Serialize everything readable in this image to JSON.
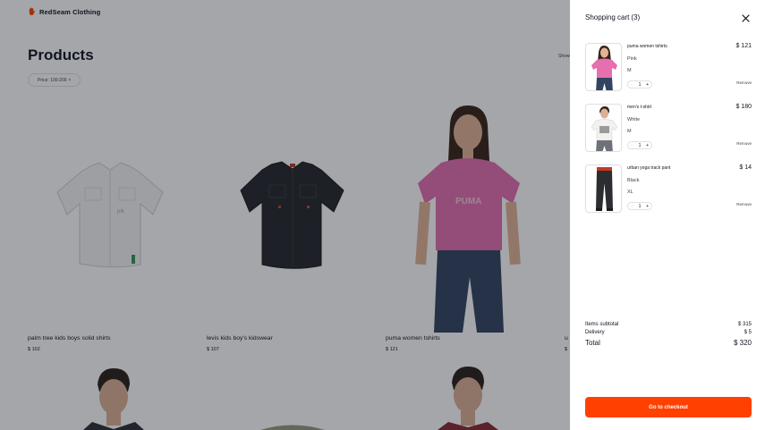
{
  "header": {
    "brand": "RedSeam Clothing",
    "logo_icon": "hand-logo-icon",
    "brand_color": "#ff4000"
  },
  "products_page": {
    "title": "Products",
    "showing_text": "Showi",
    "filter_chip": {
      "label": "Price: 100-200",
      "remove_symbol": "×"
    },
    "products": [
      {
        "name": "palm tree kids boys solid shirts",
        "price": "$ 102"
      },
      {
        "name": "levis kids boy's kidswear",
        "price": "$ 107"
      },
      {
        "name": "puma women tshirts",
        "price": "$ 121"
      },
      {
        "name": "u",
        "price": "$"
      }
    ]
  },
  "cart": {
    "title": "Shopping cart",
    "count": "(3)",
    "close_icon": "close-icon",
    "items": [
      {
        "name": "puma women tshirts",
        "color": "Pink",
        "size": "M",
        "quantity": "1",
        "price": "$ 121",
        "remove_label": "Remove",
        "minus": "−",
        "plus": "+"
      },
      {
        "name": "men's t-shirt",
        "color": "White",
        "size": "M",
        "quantity": "1",
        "price": "$ 180",
        "remove_label": "Remove",
        "minus": "−",
        "plus": "+"
      },
      {
        "name": "urban yoga track pant",
        "color": "Black",
        "size": "XL",
        "quantity": "1",
        "price": "$ 14",
        "remove_label": "Remove",
        "minus": "−",
        "plus": "+"
      }
    ],
    "subtotal_label": "Items subtotal",
    "subtotal_value": "$ 315",
    "delivery_label": "Delivery",
    "delivery_value": "$ 5",
    "total_label": "Total",
    "total_value": "$ 320",
    "checkout_label": "Go to checkout",
    "accent_color": "#ff4000"
  }
}
